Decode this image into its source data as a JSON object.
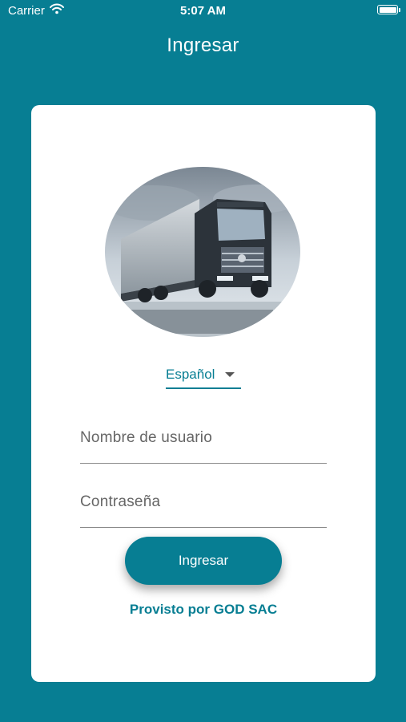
{
  "status_bar": {
    "carrier": "Carrier",
    "time": "5:07 AM"
  },
  "header": {
    "title": "Ingresar"
  },
  "login": {
    "language": "Español",
    "username_placeholder": "Nombre de usuario",
    "password_placeholder": "Contraseña",
    "submit_label": "Ingresar",
    "provider_text": "Provisto por GOD SAC"
  },
  "colors": {
    "primary": "#077e93",
    "card": "#ffffff"
  },
  "icons": [
    "wifi-icon",
    "battery-icon",
    "dropdown-caret-icon"
  ]
}
